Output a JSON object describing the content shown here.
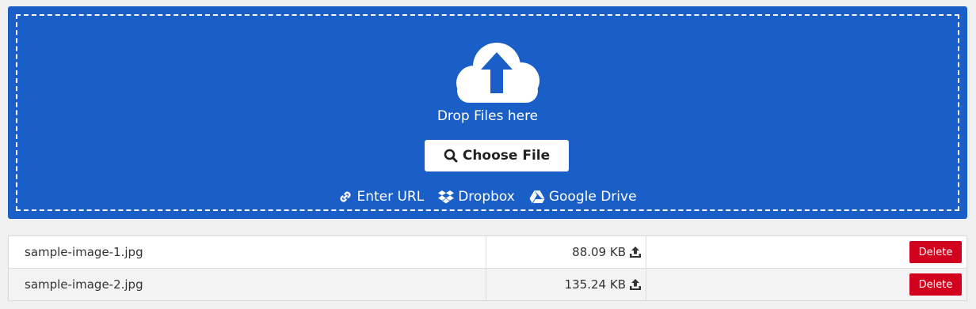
{
  "dropzone": {
    "icon": "cloud-upload-icon",
    "drop_text": "Drop Files here",
    "choose_label": "Choose File",
    "sources": [
      {
        "icon": "link-icon",
        "label": "Enter URL"
      },
      {
        "icon": "dropbox-icon",
        "label": "Dropbox"
      },
      {
        "icon": "google-drive-icon",
        "label": "Google Drive"
      }
    ]
  },
  "files": [
    {
      "name": "sample-image-1.jpg",
      "size": "88.09 KB",
      "delete_label": "Delete"
    },
    {
      "name": "sample-image-2.jpg",
      "size": "135.24 KB",
      "delete_label": "Delete"
    }
  ],
  "colors": {
    "dropzone_bg": "#1a5fc8",
    "delete_bg": "#d1021e"
  }
}
